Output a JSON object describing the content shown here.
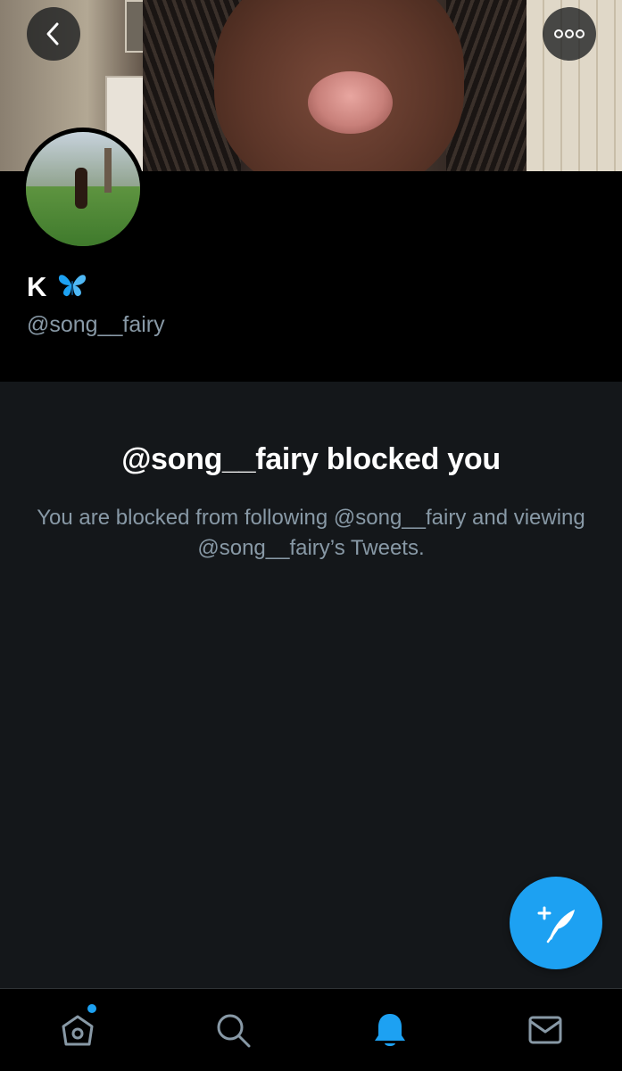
{
  "header": {
    "back_icon": "chevron-left-icon",
    "more_icon": "more-dots-icon"
  },
  "profile": {
    "display_name": "K",
    "name_emoji_icon": "butterfly-icon",
    "handle": "@song__fairy"
  },
  "blocked": {
    "title": "@song__fairy blocked you",
    "description": "You are blocked from following @song__fairy and viewing @song__fairy’s Tweets."
  },
  "fab": {
    "icon": "compose-tweet-icon"
  },
  "tabbar": {
    "items": [
      {
        "name": "home",
        "icon": "home-icon",
        "has_badge": true,
        "active": false
      },
      {
        "name": "search",
        "icon": "search-icon",
        "active": false
      },
      {
        "name": "notifications",
        "icon": "bell-icon",
        "active": true
      },
      {
        "name": "messages",
        "icon": "mail-icon",
        "active": false
      }
    ]
  },
  "colors": {
    "accent": "#1da1f2",
    "background": "#14171a",
    "secondary_text": "#8899a6"
  }
}
